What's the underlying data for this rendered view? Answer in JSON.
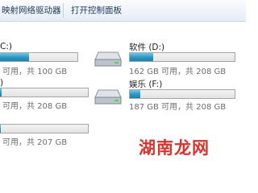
{
  "toolbar": {
    "map_drive_label": "映射网络驱动器",
    "control_panel_label": "打开控制面板"
  },
  "drives": {
    "c": {
      "name": "C:)",
      "space": "可用，共 100 GB",
      "used_fraction": 0.38
    },
    "d": {
      "name": "软件 (D:)",
      "space": "162 GB 可用，共 208 GB",
      "used_fraction": 0.22
    },
    "e": {
      "name": ")",
      "space": "可用，共 208 GB",
      "used_fraction": 0.03
    },
    "f": {
      "name": "娱乐 (F:)",
      "space": "187 GB 可用，共 208 GB",
      "used_fraction": 0.1
    },
    "g": {
      "name": "",
      "space": "可用，共 207 GB",
      "used_fraction": 0.02
    }
  },
  "watermark": {
    "text": "湖南龙网"
  },
  "colors": {
    "bar_fill": "#2a95c3",
    "watermark": "#d9332b"
  }
}
